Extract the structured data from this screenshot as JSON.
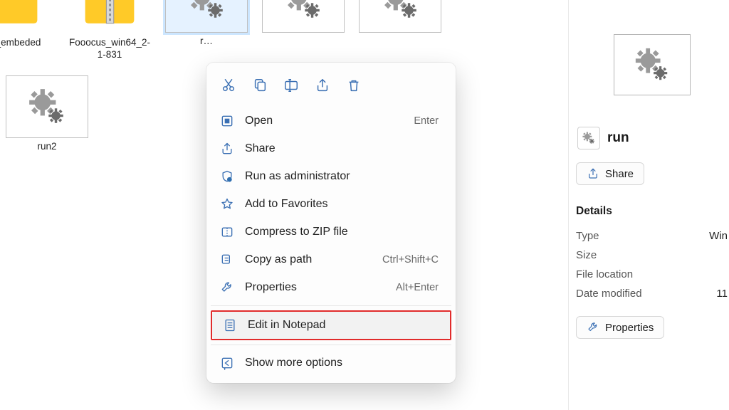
{
  "files": [
    {
      "name": "on_embeded",
      "kind": "folder"
    },
    {
      "name": "Fooocus_win64_2-1-831",
      "kind": "zipfolder"
    },
    {
      "name": "r…",
      "kind": "bat",
      "selected": true
    },
    {
      "name": "",
      "kind": "bat"
    },
    {
      "name": "",
      "kind": "bat"
    },
    {
      "name": "run2",
      "kind": "bat"
    }
  ],
  "context_menu": {
    "toolbar": [
      "cut",
      "copy",
      "rename",
      "share",
      "delete"
    ],
    "items": [
      {
        "icon": "open",
        "label": "Open",
        "shortcut": "Enter"
      },
      {
        "icon": "share",
        "label": "Share"
      },
      {
        "icon": "shield",
        "label": "Run as administrator"
      },
      {
        "icon": "star",
        "label": "Add to Favorites"
      },
      {
        "icon": "zip",
        "label": "Compress to ZIP file"
      },
      {
        "icon": "copypath",
        "label": "Copy as path",
        "shortcut": "Ctrl+Shift+C"
      },
      {
        "icon": "wrench",
        "label": "Properties",
        "shortcut": "Alt+Enter"
      }
    ],
    "highlighted": {
      "icon": "notepad",
      "label": "Edit in Notepad"
    },
    "more": {
      "icon": "more",
      "label": "Show more options"
    }
  },
  "details": {
    "filename": "run",
    "share_label": "Share",
    "section": "Details",
    "type_label": "Type",
    "type_value": "Win",
    "size_label": "Size",
    "size_value": "",
    "loc_label": "File location",
    "loc_value": "",
    "mod_label": "Date modified",
    "mod_value": "11",
    "properties_label": "Properties"
  }
}
